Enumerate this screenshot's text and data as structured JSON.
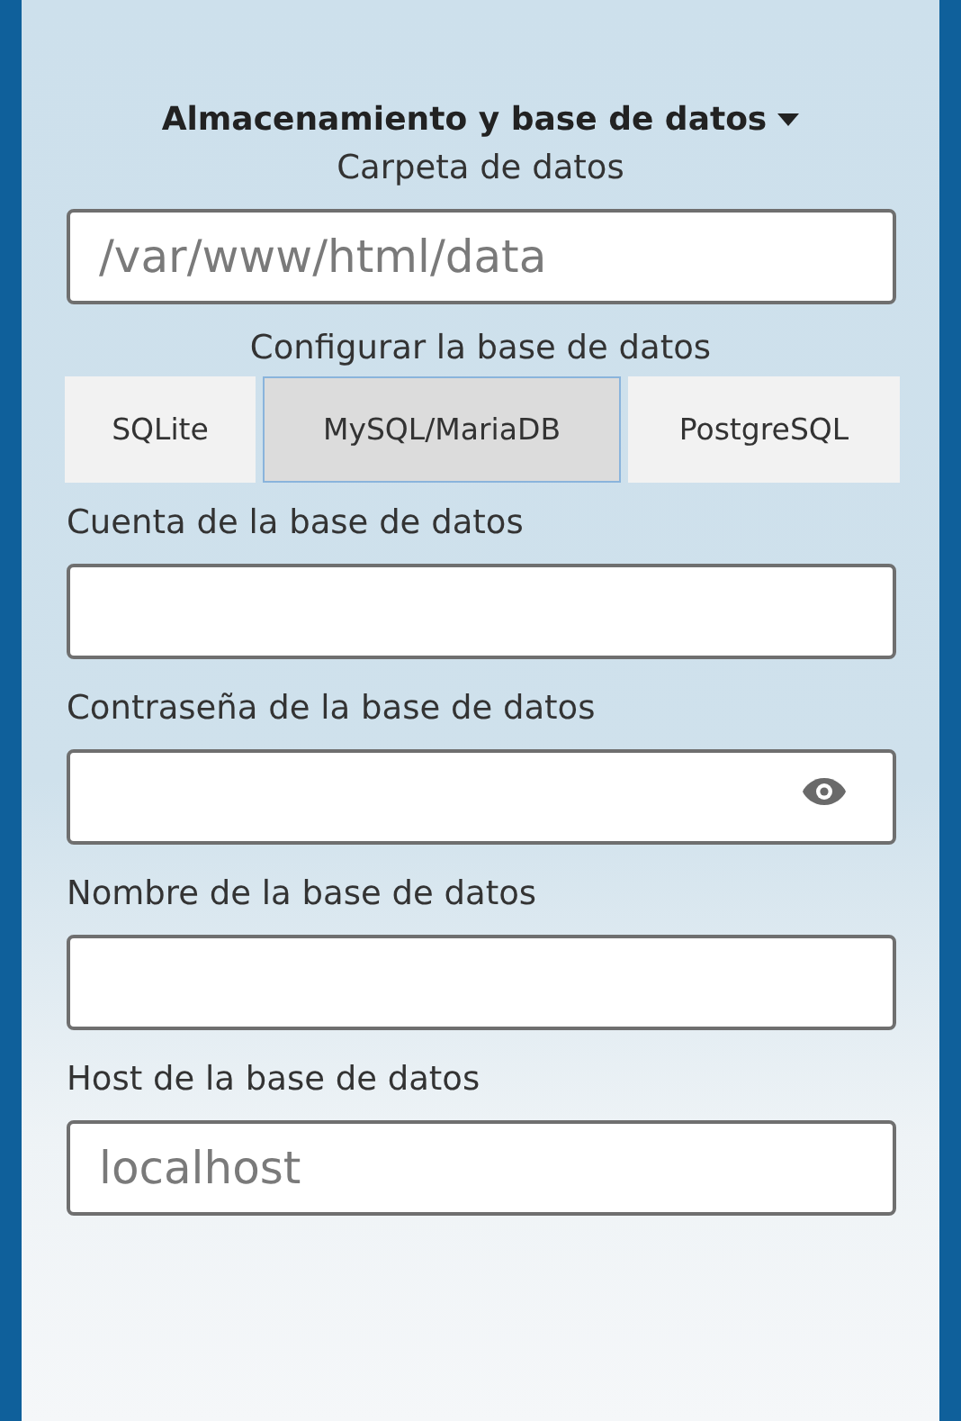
{
  "section": {
    "title": "Almacenamiento y base de datos",
    "expanded": true
  },
  "data_folder": {
    "label": "Carpeta de datos",
    "placeholder": "/var/www/html/data"
  },
  "database_type": {
    "label": "Configurar la base de datos",
    "options": [
      {
        "label": "SQLite",
        "selected": false
      },
      {
        "label": "MySQL/MariaDB",
        "selected": true
      },
      {
        "label": "PostgreSQL",
        "selected": false
      }
    ]
  },
  "fields": [
    {
      "kind": "text",
      "label": "Cuenta de la base de datos"
    },
    {
      "kind": "password",
      "label": "Contraseña de la base de datos"
    },
    {
      "kind": "text",
      "label": "Nombre de la base de datos"
    },
    {
      "kind": "text",
      "label": "Host de la base de datos",
      "placeholder": "localhost"
    }
  ]
}
